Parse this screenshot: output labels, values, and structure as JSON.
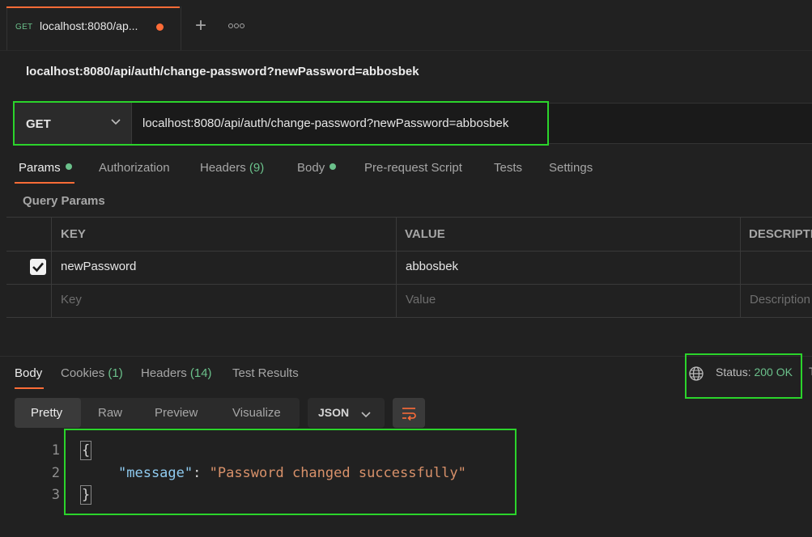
{
  "tab": {
    "method": "GET",
    "title": "localhost:8080/ap...",
    "unsaved_indicator": "#ff6c37"
  },
  "request": {
    "title": "localhost:8080/api/auth/change-password?newPassword=abbosbek",
    "method": "GET",
    "url": "localhost:8080/api/auth/change-password?newPassword=abbosbek"
  },
  "request_tabs": {
    "params": "Params",
    "authorization": "Authorization",
    "headers": "Headers",
    "headers_count": "(9)",
    "body": "Body",
    "prerequest": "Pre-request Script",
    "tests": "Tests",
    "settings": "Settings"
  },
  "query_params": {
    "label": "Query Params",
    "columns": [
      "KEY",
      "VALUE",
      "DESCRIPTI"
    ],
    "rows": [
      {
        "checked": true,
        "key": "newPassword",
        "value": "abbosbek",
        "description": ""
      }
    ],
    "placeholder": {
      "key": "Key",
      "value": "Value",
      "description": "Description"
    }
  },
  "response_tabs": {
    "body": "Body",
    "cookies": "Cookies",
    "cookies_count": "(1)",
    "headers": "Headers",
    "headers_count": "(14)",
    "test_results": "Test Results"
  },
  "status": {
    "label": "Status:",
    "value": "200 OK",
    "extra": "T"
  },
  "view_modes": {
    "pretty": "Pretty",
    "raw": "Raw",
    "preview": "Preview",
    "visualize": "Visualize",
    "format": "JSON"
  },
  "code": {
    "line_numbers": [
      "1",
      "2",
      "3"
    ],
    "open_brace": "{",
    "key": "\"message\"",
    "colon": ": ",
    "value": "\"Password changed successfully\"",
    "close_brace": "}"
  },
  "icons": {
    "add_tab": "plus-icon",
    "more": "more-horizontal-icon",
    "method_dropdown": "chevron-down-icon",
    "checkbox": "checkmark-icon",
    "network": "globe-icon",
    "wrap": "wrap-lines-icon"
  },
  "colors": {
    "accent": "#ff6c37",
    "success": "#6bc18b",
    "highlight": "#2bd42b",
    "background": "#212121"
  }
}
